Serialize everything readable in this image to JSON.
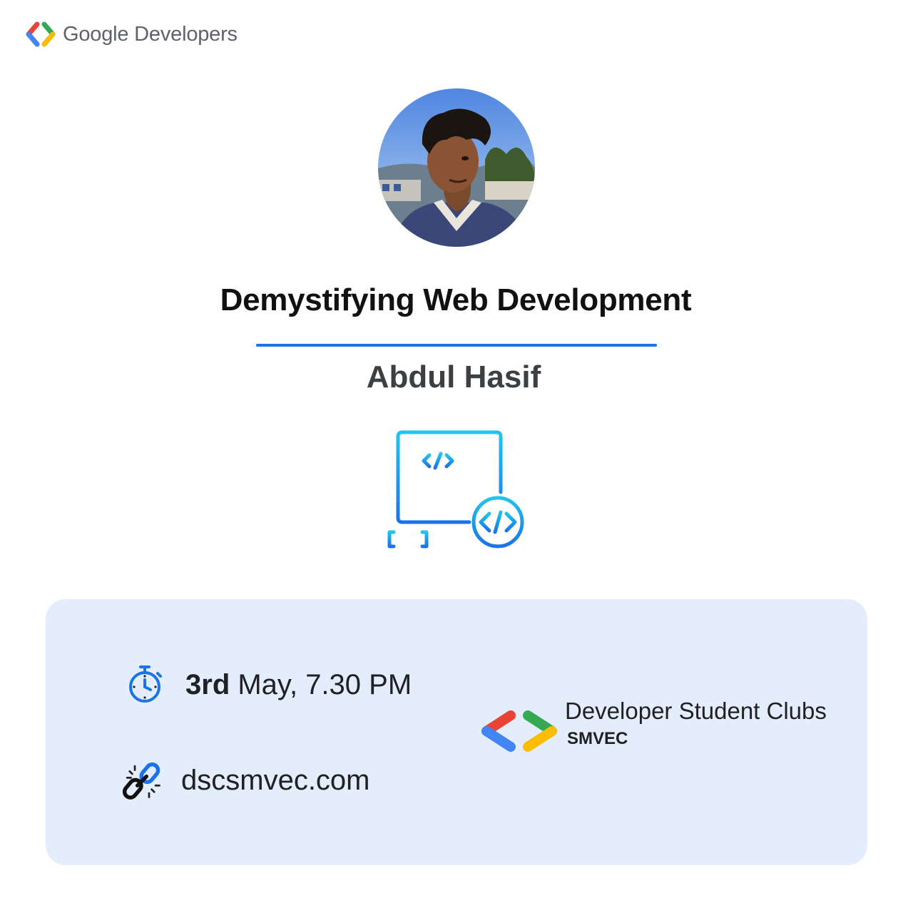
{
  "header": {
    "brand_text": "Google Developers",
    "logo_icon": "google-developers-logo"
  },
  "event": {
    "title": "Demystifying Web Development",
    "speaker": "Abdul Hasif",
    "topic_icon": "web-development-code-icon"
  },
  "details": {
    "date_day": "3rd",
    "date_rest": " May, 7.30 PM",
    "time_icon": "stopwatch-icon",
    "website": "dscsmvec.com",
    "link_icon": "chain-link-icon"
  },
  "club": {
    "name": "Developer Student Clubs",
    "chapter": "SMVEC",
    "logo_icon": "dsc-logo-icon"
  },
  "colors": {
    "accent_blue": "#1a73e8",
    "card_background": "#e4edfc",
    "google_red": "#ea4335",
    "google_blue": "#4285f4",
    "google_green": "#34a853",
    "google_yellow": "#fbbc04"
  }
}
